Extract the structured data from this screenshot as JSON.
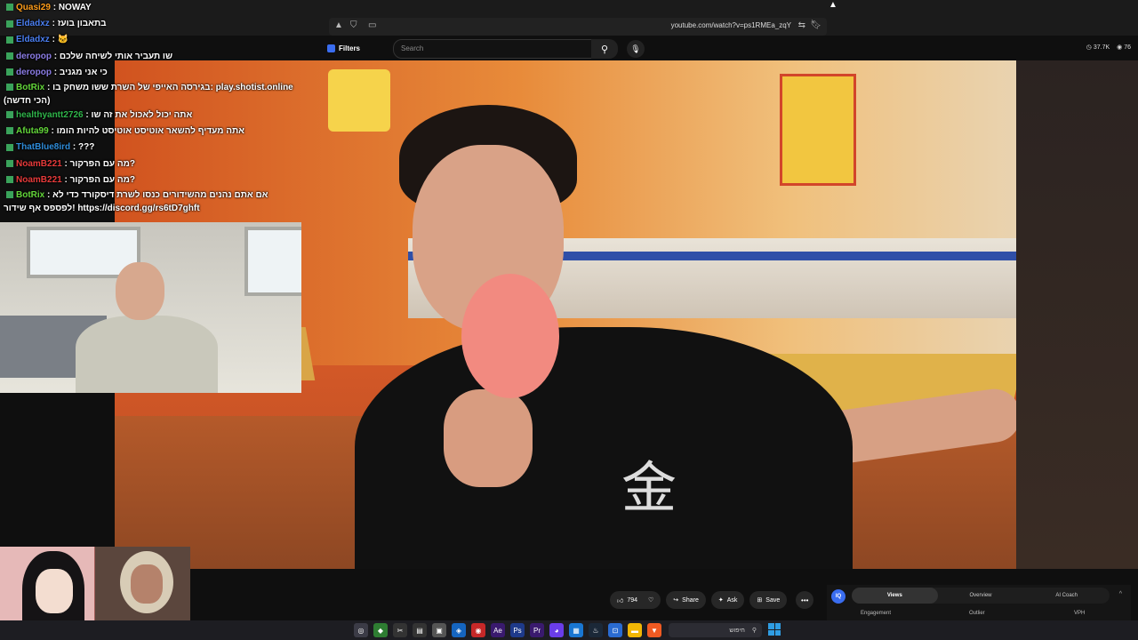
{
  "browser": {
    "url": "youtube.com/watch?v=ps1RMEa_zqY"
  },
  "youtube": {
    "filters_label": "Filters",
    "search_placeholder": "Search",
    "views_stat": "37.7K",
    "likes_stat": "76",
    "like_count": "794",
    "share_label": "Share",
    "ask_label": "Ask",
    "save_label": "Save"
  },
  "chat": [
    {
      "user": "Quasi29",
      "color": "#ff9d1a",
      "text": "NOWAY"
    },
    {
      "user": "Eldadxz",
      "color": "#4a7ef0",
      "text": "בתאבון בועז"
    },
    {
      "user": "Eldadxz",
      "color": "#4a7ef0",
      "text": "🐱"
    },
    {
      "user": "deropop",
      "color": "#8a7be3",
      "text": "שו תעביר אותי לשיחה שלכם"
    },
    {
      "user": "deropop",
      "color": "#8a7be3",
      "text": "כי אני מגניב"
    },
    {
      "user": "BotRix",
      "color": "#63d63a",
      "text": "בגירסה האייפי של השרת ששו משחק בו: play.shotist.online (הכי חדשה)"
    },
    {
      "user": "healthyantt2726",
      "color": "#2fb54a",
      "text": "אתה יכול לאכול את זה שו"
    },
    {
      "user": "Afuta99",
      "color": "#63d63a",
      "text": "אתה מעדיף להשאר אוטיסט אוטיסט להיות הומו"
    },
    {
      "user": "ThatBlue8ird",
      "color": "#2e8bd8",
      "text": "???"
    },
    {
      "user": "NoamB221",
      "color": "#e63a3a",
      "text": "מה עם הפרקור?"
    },
    {
      "user": "NoamB221",
      "color": "#e63a3a",
      "text": "מה עם הפרקור?"
    },
    {
      "user": "BotRix",
      "color": "#63d63a",
      "text": "אם אתם נהנים מהשידורים כנסו לשרת דיסקורד כדי לא לפספס אף שידור! https://discord.gg/rs6tD7ghft"
    }
  ],
  "iq": {
    "logo": "IQ",
    "tabs": [
      "Views",
      "Overview",
      "AI Coach"
    ],
    "sub": [
      "Engagement",
      "Outlier",
      "VPH"
    ]
  },
  "taskbar": {
    "search_text": "חיפוש"
  },
  "icons": [
    "search-icon",
    "mic-icon",
    "like-icon",
    "dislike-icon",
    "share-icon",
    "save-icon",
    "more-icon"
  ]
}
